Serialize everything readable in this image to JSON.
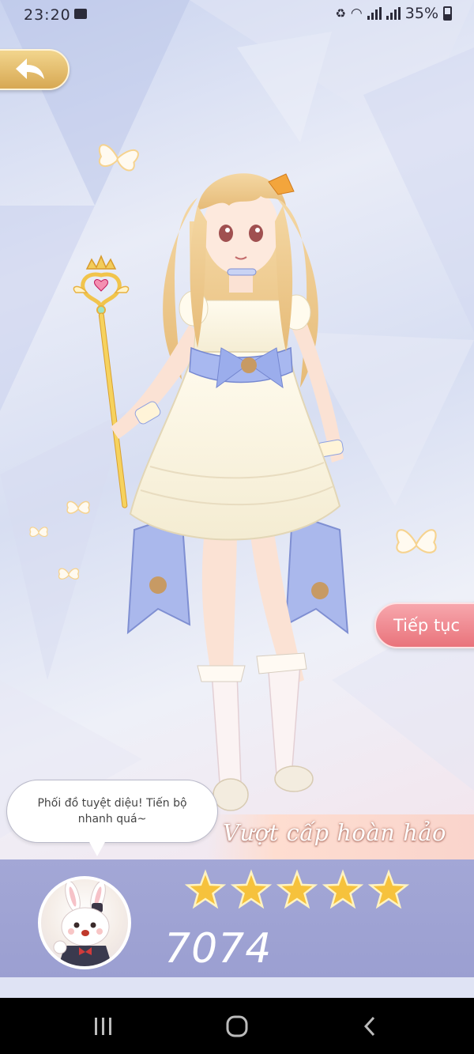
{
  "status_bar": {
    "time": "23:20",
    "battery": "35%"
  },
  "back_button": {
    "icon": "back-arrow-icon"
  },
  "continue_button": {
    "label": "Tiếp tục"
  },
  "speech_bubble": {
    "text": "Phối đồ tuyệt diệu! Tiến bộ nhanh quá~"
  },
  "result": {
    "rank_text": "Vượt cấp hoàn hảo",
    "stars": 5,
    "max_stars": 5,
    "score": "7074"
  },
  "colors": {
    "accent_gold": "#e8b13f",
    "continue_pink": "#ee7b83",
    "panel_purple": "#a1a5d5"
  },
  "navbar": {
    "recent_icon": "recent-apps-icon",
    "home_icon": "home-icon",
    "back_icon": "nav-back-icon"
  }
}
